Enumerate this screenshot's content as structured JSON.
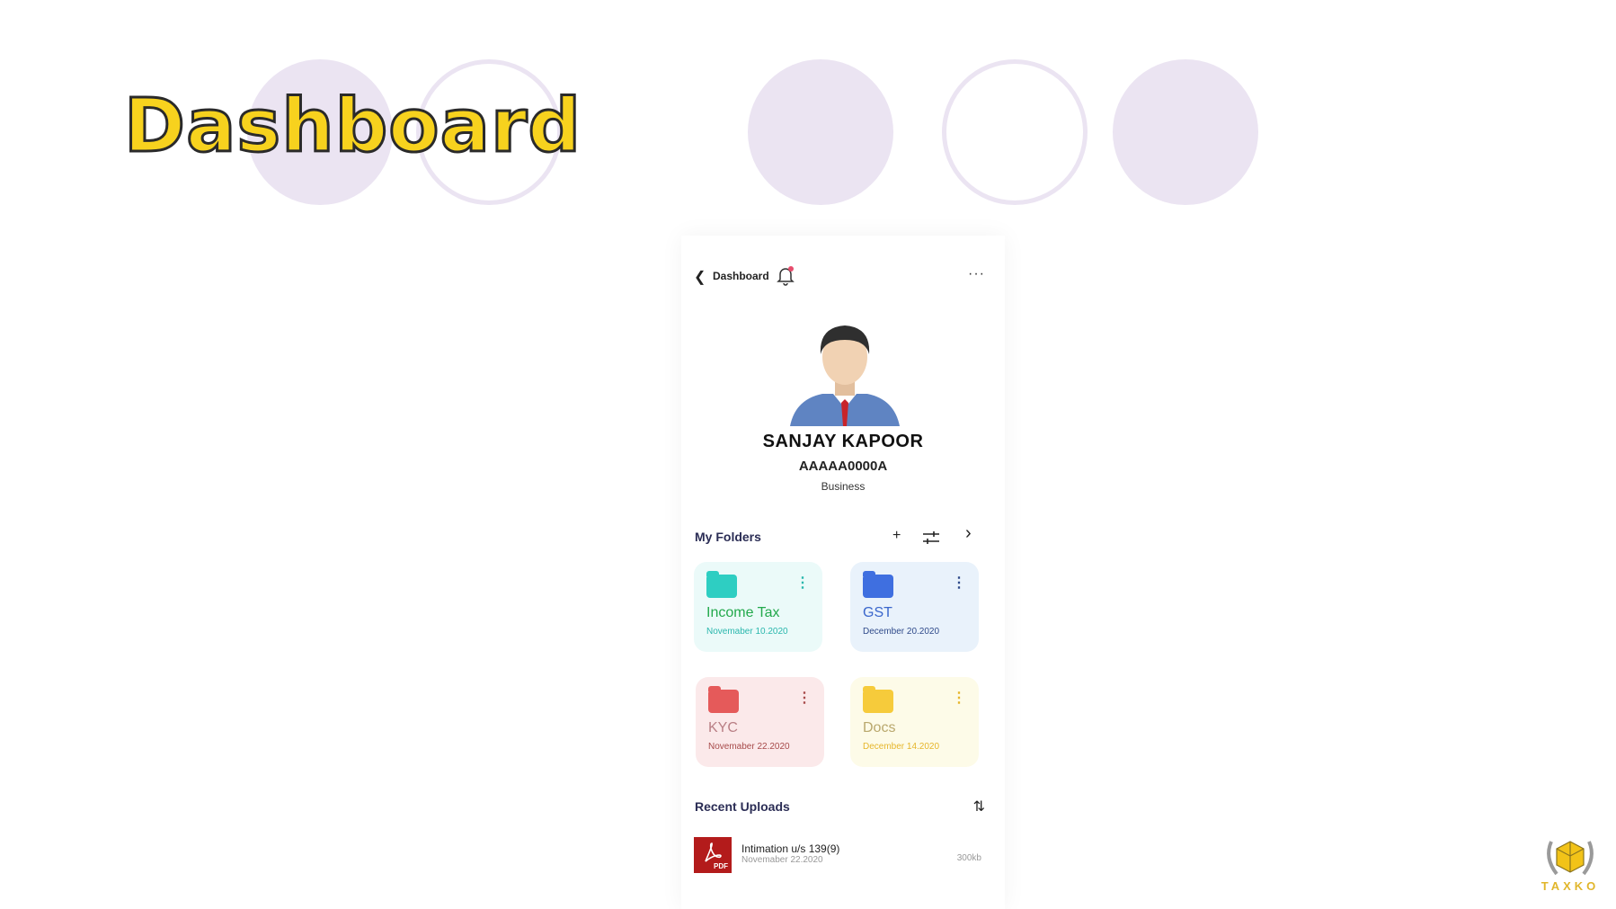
{
  "slide": {
    "title": "Dashboard"
  },
  "topbar": {
    "back_icon": "chevron-left-icon",
    "title": "Dashboard",
    "bell_icon": "bell-icon",
    "more_icon": "more-horizontal-icon",
    "more_glyph": "···"
  },
  "profile": {
    "name": "SANJAY KAPOOR",
    "pan": "AAAAA0000A",
    "type": "Business"
  },
  "folders": {
    "title": "My Folders",
    "add_glyph": "+",
    "filter_icon": "sliders-icon",
    "next_glyph": "›",
    "items": [
      {
        "label": "Income Tax",
        "date": "Novemaber 10.2020",
        "color": "#2ecec2"
      },
      {
        "label": "GST",
        "date": "December 20.2020",
        "color": "#3f6fe0"
      },
      {
        "label": "KYC",
        "date": "Novemaber 22.2020",
        "color": "#e55a5a"
      },
      {
        "label": "Docs",
        "date": "December 14.2020",
        "color": "#f6cb3b"
      }
    ]
  },
  "recent": {
    "title": "Recent Uploads",
    "sort_glyph": "⇅",
    "files": [
      {
        "name": "Intimation u/s 139(9)",
        "date": "Novemaber 22.2020",
        "size": "300kb",
        "badge": "PDF"
      }
    ]
  },
  "brand": {
    "text": "TAXKO",
    "accent": "#e1b62b"
  }
}
